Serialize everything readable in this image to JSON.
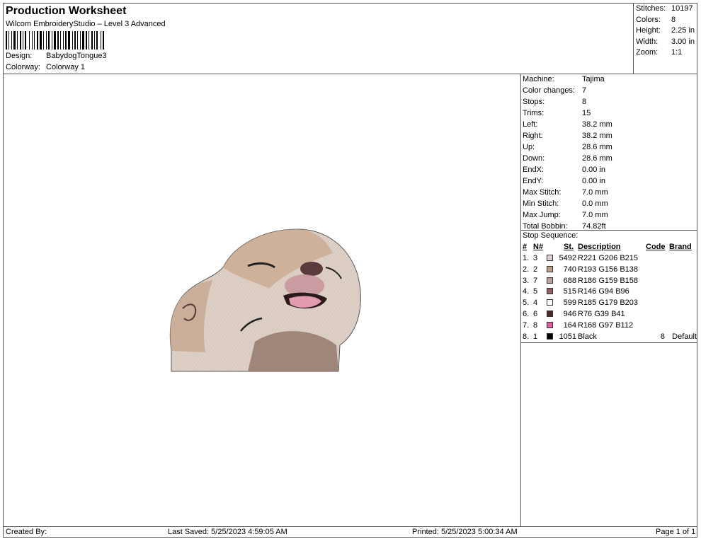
{
  "header": {
    "title": "Production Worksheet",
    "software": "Wilcom EmbroideryStudio – Level 3 Advanced",
    "design_label": "Design:",
    "design_value": "BabydogTongue3",
    "colorway_label": "Colorway:",
    "colorway_value": "Colorway 1"
  },
  "summary": [
    {
      "label": "Stitches:",
      "value": "10197"
    },
    {
      "label": "Colors:",
      "value": "8"
    },
    {
      "label": "Height:",
      "value": "2.25 in"
    },
    {
      "label": "Width:",
      "value": "3.00 in"
    },
    {
      "label": "Zoom:",
      "value": "1:1"
    }
  ],
  "machine_info": [
    {
      "label": "Machine:",
      "value": "Tajima"
    },
    {
      "label": "Color changes:",
      "value": "7"
    },
    {
      "label": "Stops:",
      "value": "8"
    },
    {
      "label": "Trims:",
      "value": "15"
    },
    {
      "label": "Left:",
      "value": "38.2 mm"
    },
    {
      "label": "Right:",
      "value": "38.2 mm"
    },
    {
      "label": "Up:",
      "value": "28.6 mm"
    },
    {
      "label": "Down:",
      "value": "28.6 mm"
    },
    {
      "label": "EndX:",
      "value": "0.00 in"
    },
    {
      "label": "EndY:",
      "value": "0.00 in"
    },
    {
      "label": "Max Stitch:",
      "value": "7.0 mm"
    },
    {
      "label": "Min Stitch:",
      "value": "0.0 mm"
    },
    {
      "label": "Max Jump:",
      "value": "7.0 mm"
    },
    {
      "label": "Total Bobbin:",
      "value": "74.82ft"
    }
  ],
  "stop_sequence": {
    "title": "Stop Sequence:",
    "headers": {
      "num": "#",
      "n": "N#",
      "st": "St.",
      "desc": "Description",
      "code": "Code",
      "brand": "Brand"
    },
    "rows": [
      {
        "num": "1.",
        "n": "3",
        "color": "#DDCED7",
        "st": "5492",
        "desc": "R221 G206 B215",
        "code": "",
        "brand": ""
      },
      {
        "num": "2.",
        "n": "2",
        "color": "#C19C8A",
        "st": "740",
        "desc": "R193 G156 B138",
        "code": "",
        "brand": ""
      },
      {
        "num": "3.",
        "n": "7",
        "color": "#BA9F9E",
        "st": "688",
        "desc": "R186 G159 B158",
        "code": "",
        "brand": ""
      },
      {
        "num": "4.",
        "n": "5",
        "color": "#925E60",
        "st": "515",
        "desc": "R146 G94 B96",
        "code": "",
        "brand": ""
      },
      {
        "num": "5.",
        "n": "4",
        "color": "#FFFFFF",
        "st": "599",
        "desc": "R185 G179 B203",
        "code": "",
        "brand": ""
      },
      {
        "num": "6.",
        "n": "6",
        "color": "#4C2729",
        "st": "946",
        "desc": "R76 G39 B41",
        "code": "",
        "brand": ""
      },
      {
        "num": "7.",
        "n": "8",
        "color": "#D8619C",
        "st": "164",
        "desc": "R168 G97 B112",
        "code": "",
        "brand": ""
      },
      {
        "num": "8.",
        "n": "1",
        "color": "#000000",
        "st": "1051",
        "desc": "Black",
        "code": "8",
        "brand": "Default"
      }
    ]
  },
  "footer": {
    "created": "Created By:",
    "saved": "Last Saved: 5/25/2023 4:59:05 AM",
    "printed": "Printed: 5/25/2023 5:00:34 AM",
    "page": "Page 1 of 1"
  }
}
